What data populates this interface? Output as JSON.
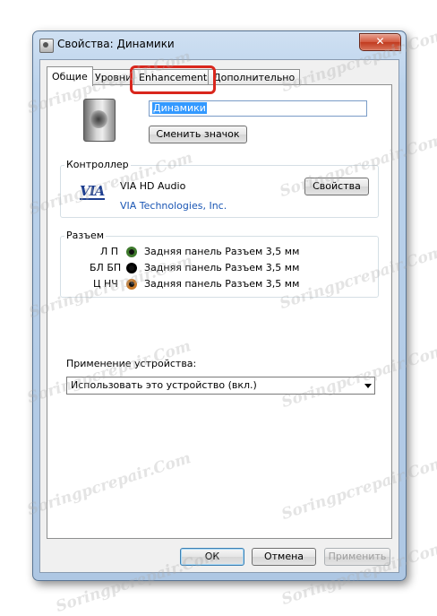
{
  "window": {
    "title": "Свойства: Динамики",
    "close_symbol": "✕"
  },
  "tabs": [
    {
      "label": "Общие",
      "active": true
    },
    {
      "label": "Уровни",
      "active": false
    },
    {
      "label": "Enhancements",
      "active": false,
      "highlighted": true
    },
    {
      "label": "Дополнительно",
      "active": false
    }
  ],
  "device": {
    "icon": "speaker-icon",
    "name": "Динамики",
    "change_icon_label": "Сменить значок"
  },
  "controller": {
    "label": "Контроллер",
    "logo_text": "VIA",
    "name": "VIA HD Audio",
    "vendor": "VIA Technologies, Inc.",
    "properties_label": "Свойства"
  },
  "jacks": {
    "label": "Разъем",
    "items": [
      {
        "channel": "Л П",
        "description": "Задняя панель Разъем 3,5 мм",
        "color": "#3f7a2d"
      },
      {
        "channel": "БЛ БП",
        "description": "Задняя панель Разъем 3,5 мм",
        "color": "#000000"
      },
      {
        "channel": "Ц НЧ",
        "description": "Задняя панель Разъем 3,5 мм",
        "color": "#c87a2a"
      }
    ]
  },
  "usage": {
    "label": "Применение устройства:",
    "selected": "Использовать это устройство (вкл.)"
  },
  "buttons": {
    "ok": "ОК",
    "cancel": "Отмена",
    "apply": "Применить"
  },
  "watermark": "Soringpcrepair.Com",
  "colors": {
    "highlight_ring": "#d9261c",
    "link": "#1a56b4",
    "selection": "#3399ff"
  }
}
